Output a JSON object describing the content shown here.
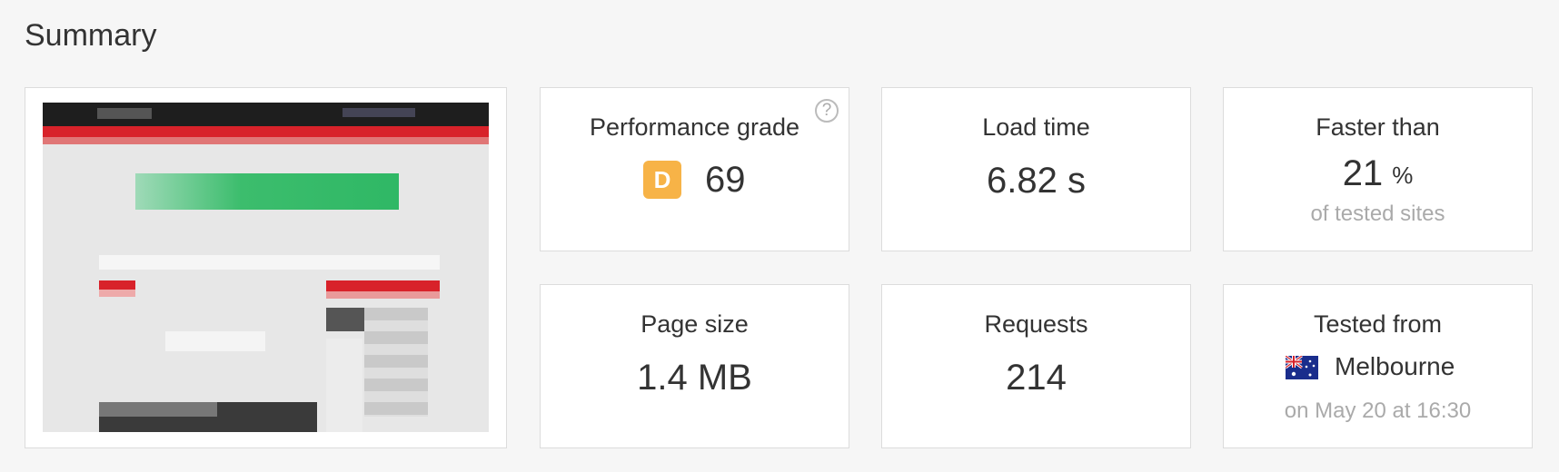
{
  "summary": {
    "title": "Summary"
  },
  "thumbnail": {
    "alt": "Website screenshot preview"
  },
  "metrics": {
    "performance": {
      "label": "Performance grade",
      "grade": "D",
      "value": "69",
      "help": "?",
      "grade_color": "#f7b347"
    },
    "load_time": {
      "label": "Load time",
      "value": "6.82 s"
    },
    "faster_than": {
      "label": "Faster than",
      "value": "21",
      "unit": "%",
      "sub": "of tested sites"
    },
    "page_size": {
      "label": "Page size",
      "value": "1.4 MB"
    },
    "requests": {
      "label": "Requests",
      "value": "214"
    },
    "tested_from": {
      "label": "Tested from",
      "flag_icon": "australia-flag-icon",
      "location": "Melbourne",
      "sub": "on May 20 at 16:30"
    }
  }
}
